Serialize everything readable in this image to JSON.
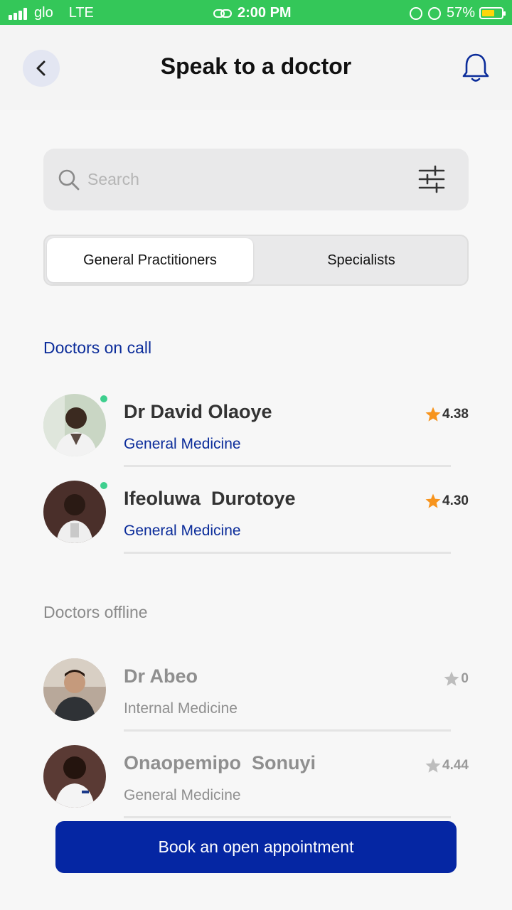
{
  "status_bar": {
    "carrier": "glo",
    "network": "LTE",
    "time": "2:00 PM",
    "battery": "57%"
  },
  "header": {
    "title": "Speak to a doctor"
  },
  "search": {
    "placeholder": "Search"
  },
  "tabs": [
    {
      "label": "General Practitioners",
      "active": true
    },
    {
      "label": "Specialists",
      "active": false
    }
  ],
  "sections": {
    "on_call": "Doctors on call",
    "offline": "Doctors offline"
  },
  "doctors_on_call": [
    {
      "name": "Dr David Olaoye",
      "specialty": "General Medicine",
      "rating": "4.38"
    },
    {
      "name": "Ifeoluwa  Durotoye",
      "specialty": "General Medicine",
      "rating": "4.30"
    }
  ],
  "doctors_offline": [
    {
      "name": "Dr Abeo",
      "specialty": "Internal Medicine",
      "rating": "0"
    },
    {
      "name": "Onaopemipo  Sonuyi",
      "specialty": "General Medicine",
      "rating": "4.44"
    }
  ],
  "book_button": {
    "label": "Book an open appointment"
  },
  "colors": {
    "brand": "#0526a3",
    "accent_text": "#0b2c9a",
    "online": "#3ecf8e",
    "star_active": "#f7941d",
    "star_inactive": "#bdbdbd",
    "status_bar": "#34c759"
  }
}
